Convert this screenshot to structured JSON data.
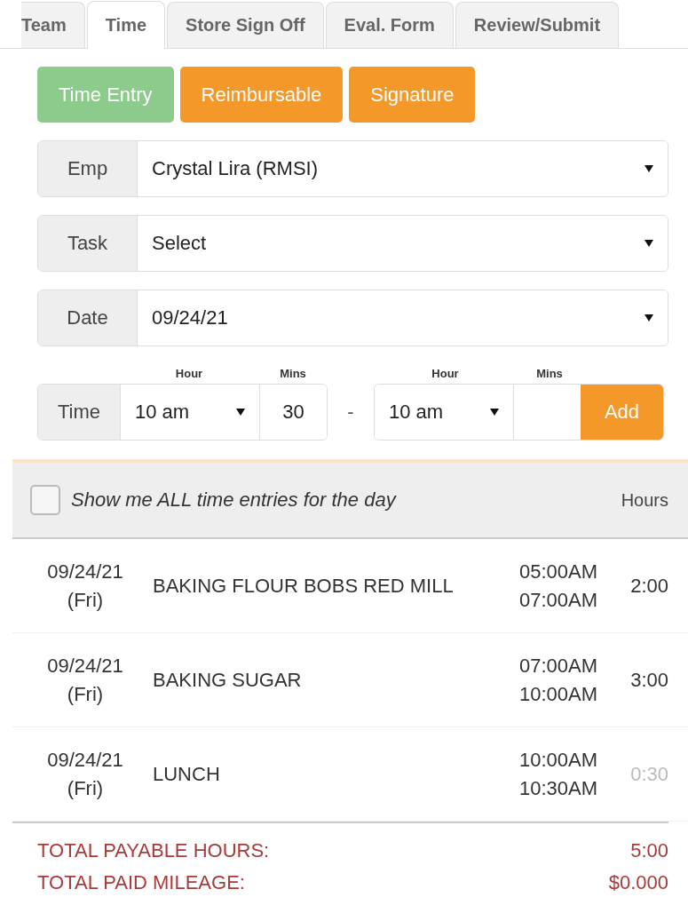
{
  "tabs": [
    {
      "label": "Team",
      "selected": false
    },
    {
      "label": "Time",
      "selected": true
    },
    {
      "label": "Store Sign Off",
      "selected": false
    },
    {
      "label": "Eval. Form",
      "selected": false
    },
    {
      "label": "Review/Submit",
      "selected": false
    }
  ],
  "modes": [
    {
      "label": "Time Entry",
      "selected": true
    },
    {
      "label": "Reimbursable",
      "selected": false
    },
    {
      "label": "Signature",
      "selected": false
    }
  ],
  "fields": [
    {
      "label": "Emp",
      "value": "Crystal Lira (RMSI)"
    },
    {
      "label": "Task",
      "value": "Select"
    },
    {
      "label": "Date",
      "value": "09/24/21"
    }
  ],
  "time": {
    "label": "Time",
    "start_hour_label": "Hour",
    "start_mins_label": "Mins",
    "start_hour": "10 am",
    "start_mins": "30",
    "separator": "-",
    "end_hour_label": "Hour",
    "end_mins_label": "Mins",
    "end_hour": "10 am",
    "add_button": "Add"
  },
  "list_header": {
    "show_all_label": "Show me ALL time entries for the day",
    "show_all_checked": false,
    "hours_heading": "Hours"
  },
  "entries": [
    {
      "date": "09/24/21",
      "day": "(Fri)",
      "task": "BAKING FLOUR BOBS RED MILL",
      "start": "05:00AM",
      "end": "07:00AM",
      "hours": "2:00",
      "payable": true
    },
    {
      "date": "09/24/21",
      "day": "(Fri)",
      "task": "BAKING SUGAR",
      "start": "07:00AM",
      "end": "10:00AM",
      "hours": "3:00",
      "payable": true
    },
    {
      "date": "09/24/21",
      "day": "(Fri)",
      "task": "LUNCH",
      "start": "10:00AM",
      "end": "10:30AM",
      "hours": "0:30",
      "payable": false
    }
  ],
  "totals": [
    {
      "label": "TOTAL PAYABLE HOURS:",
      "value": "5:00"
    },
    {
      "label": "TOTAL PAID MILEAGE:",
      "value": "$0.000"
    }
  ]
}
